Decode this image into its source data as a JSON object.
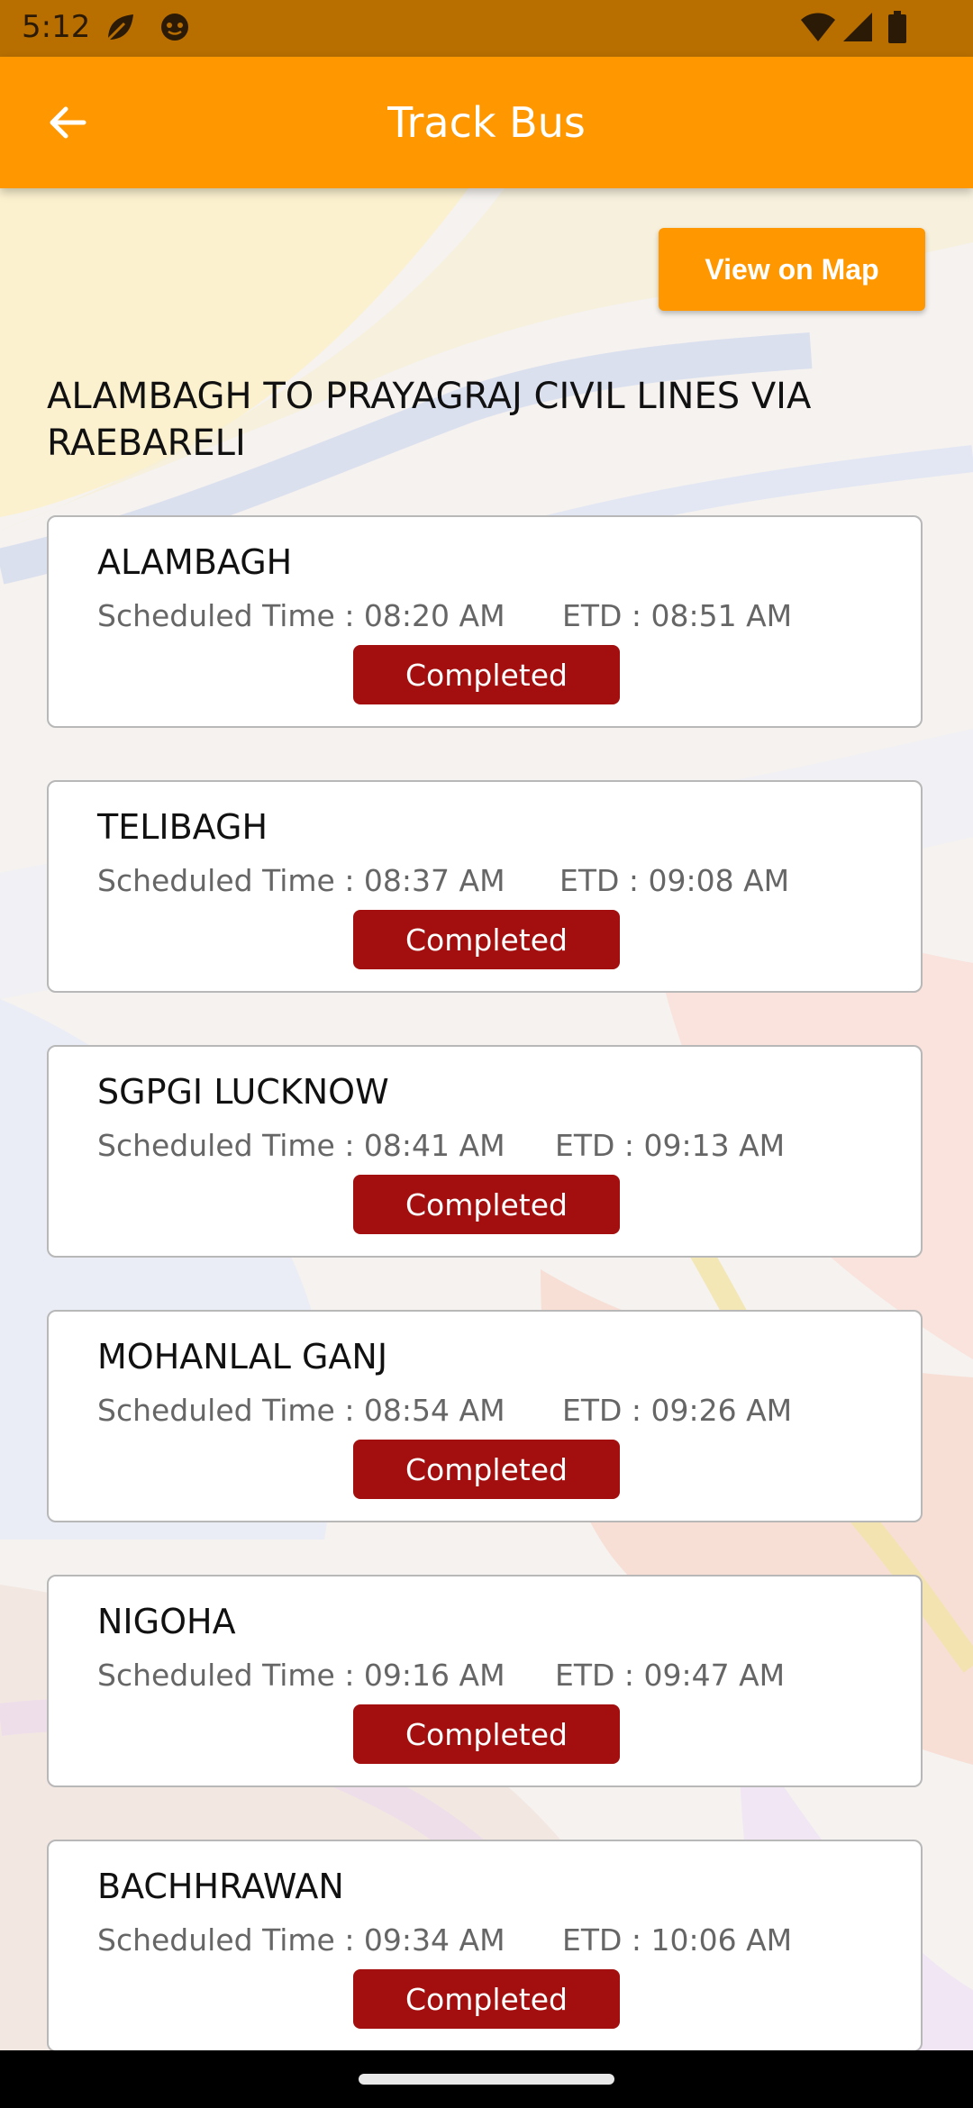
{
  "status_bar": {
    "time": "5:12",
    "icons_left": [
      "leaf-icon",
      "face-icon"
    ],
    "icons_right": [
      "wifi-icon",
      "signal-icon",
      "battery-icon"
    ]
  },
  "app_bar": {
    "title": "Track Bus",
    "back_icon": "arrow-left-icon",
    "color": "#ff9800"
  },
  "actions": {
    "view_on_map": "View on Map"
  },
  "route": {
    "title": "ALAMBAGH TO PRAYAGRAJ CIVIL LINES VIA RAEBARELI"
  },
  "stops": [
    {
      "name": "ALAMBAGH",
      "scheduled": "Scheduled Time : 08:20 AM",
      "etd": "ETD : 08:51 AM",
      "status": "Completed"
    },
    {
      "name": "TELIBAGH",
      "scheduled": "Scheduled Time : 08:37 AM",
      "etd": "ETD : 09:08 AM",
      "status": "Completed"
    },
    {
      "name": "SGPGI LUCKNOW",
      "scheduled": "Scheduled Time : 08:41 AM",
      "etd": "ETD : 09:13 AM",
      "status": "Completed"
    },
    {
      "name": "MOHANLAL GANJ",
      "scheduled": "Scheduled Time : 08:54 AM",
      "etd": "ETD : 09:26 AM",
      "status": "Completed"
    },
    {
      "name": "NIGOHA",
      "scheduled": "Scheduled Time : 09:16 AM",
      "etd": "ETD : 09:47 AM",
      "status": "Completed"
    },
    {
      "name": "BACHHRAWAN",
      "scheduled": "Scheduled Time : 09:34 AM",
      "etd": "ETD : 10:06 AM",
      "status": "Completed"
    }
  ],
  "colors": {
    "status_bar": "#b86f00",
    "accent": "#ff9800",
    "completed_badge": "#a30f0f"
  }
}
